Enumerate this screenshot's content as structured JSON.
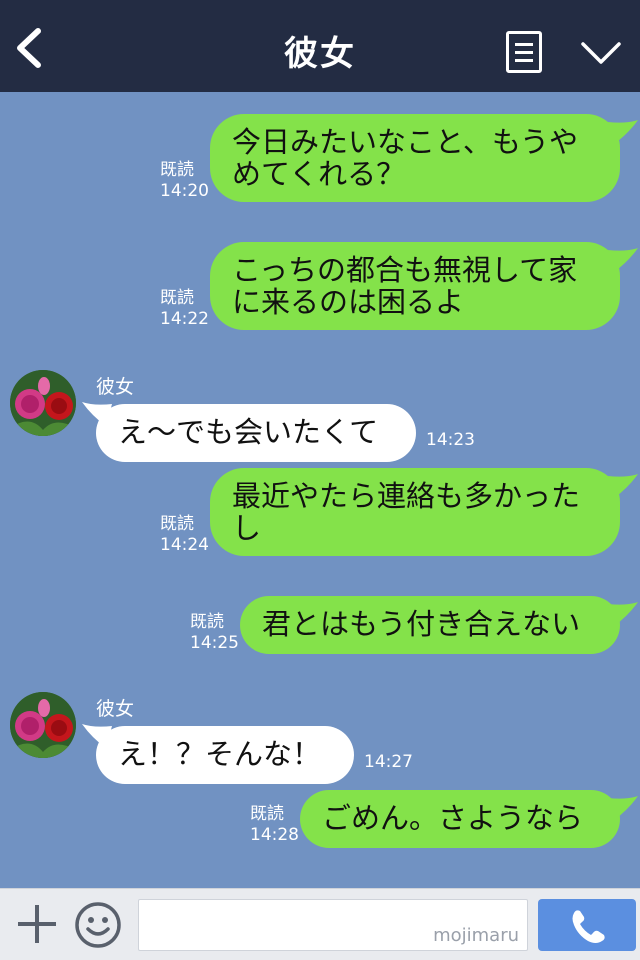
{
  "header": {
    "title": "彼女"
  },
  "messages": [
    {
      "side": "me",
      "read": "既読",
      "time": "14:20",
      "lines": [
        "今日みたいなこと、もうや",
        "めてくれる？"
      ]
    },
    {
      "side": "me",
      "read": "既読",
      "time": "14:22",
      "lines": [
        "こっちの都合も無視して家",
        "に来るのは困るよ"
      ]
    },
    {
      "side": "them",
      "sender": "彼女",
      "time": "14:23",
      "lines": [
        "え〜でも会いたくて"
      ]
    },
    {
      "side": "me",
      "read": "既読",
      "time": "14:24",
      "lines": [
        "最近やたら連絡も多かった",
        "し"
      ]
    },
    {
      "side": "me",
      "read": "既読",
      "time": "14:25",
      "lines": [
        "君とはもう付き合えない"
      ]
    },
    {
      "side": "them",
      "sender": "彼女",
      "time": "14:27",
      "lines": [
        "え！？そんな！"
      ]
    },
    {
      "side": "me",
      "read": "既読",
      "time": "14:28",
      "lines": [
        "ごめん。さようなら"
      ]
    }
  ],
  "bottom": {
    "watermark": "mojimaru"
  },
  "icons": {
    "back": "chevron-left-icon",
    "notes": "notes-icon",
    "menu": "chevron-down-icon",
    "plus": "plus-icon",
    "emoji": "smile-icon",
    "call": "phone-icon"
  },
  "colors": {
    "header_bg": "#232c43",
    "chat_bg": "#7192c2",
    "my_bubble": "#84e24a",
    "their_bubble": "#ffffff",
    "call_button": "#5b8fe0"
  }
}
